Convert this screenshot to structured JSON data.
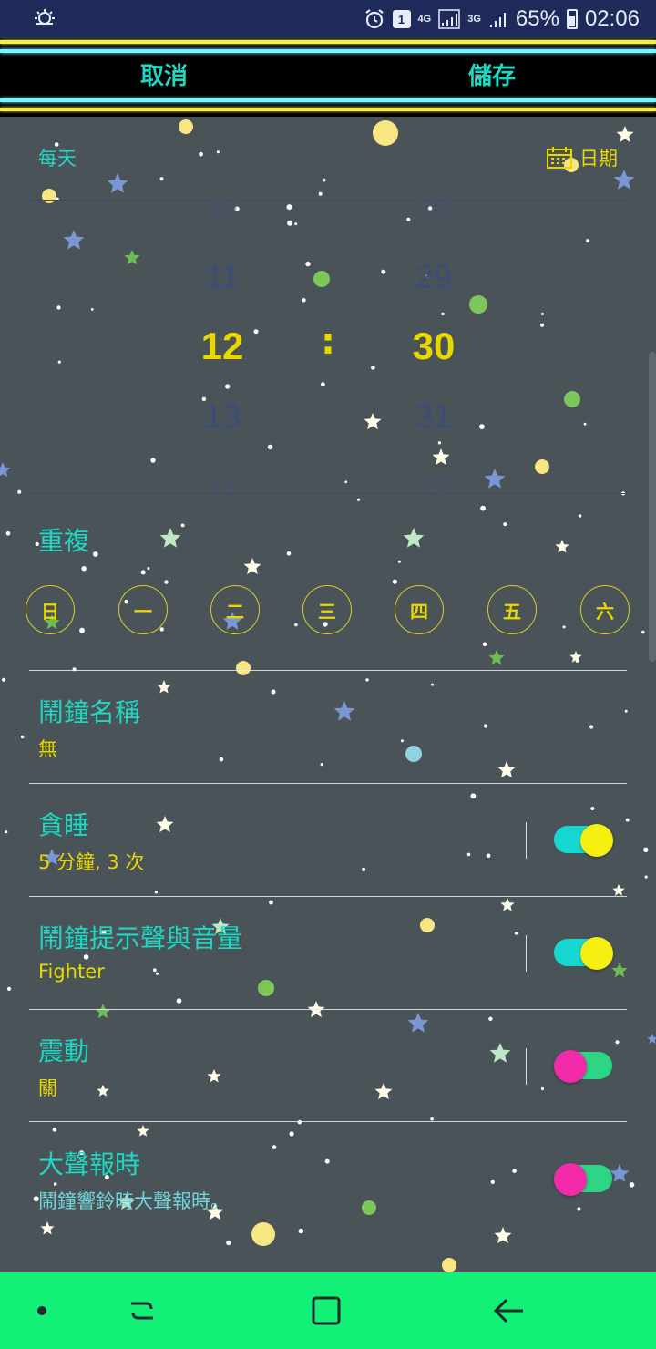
{
  "status_bar": {
    "left_icon": "weather-icon",
    "alarm_icon": "alarm-clock-icon",
    "sim_label": "1",
    "network1": "4G",
    "network2": "3G",
    "battery": "65%",
    "time": "02:06"
  },
  "top_bar": {
    "cancel": "取消",
    "save": "儲存"
  },
  "mode": {
    "label": "每天",
    "date_label": "日期",
    "date_icon": "calendar-icon"
  },
  "picker": {
    "hours": [
      "10",
      "11",
      "12",
      "13",
      "14"
    ],
    "minutes": [
      "28",
      "29",
      "30",
      "31",
      "32"
    ],
    "separator": ":"
  },
  "repeat": {
    "title": "重複",
    "days": [
      "日",
      "一",
      "二",
      "三",
      "四",
      "五",
      "六"
    ]
  },
  "settings": [
    {
      "title": "鬧鐘名稱",
      "subtitle": "無",
      "toggle": null
    },
    {
      "title": "貪睡",
      "subtitle": "5 分鐘, 3 次",
      "toggle": "on"
    },
    {
      "title": "鬧鐘提示聲與音量",
      "subtitle": "Fighter",
      "toggle": "on"
    },
    {
      "title": "震動",
      "subtitle": "關",
      "toggle": "off"
    },
    {
      "title": "大聲報時",
      "subtitle": "鬧鐘響鈴時大聲報時。",
      "toggle": "off"
    }
  ],
  "nav_bar": {
    "dot": "home-dot-icon",
    "recents": "recent-apps-icon",
    "home": "home-button-icon",
    "back": "back-arrow-icon"
  },
  "colors": {
    "background": "#4a5358",
    "accent_cyan": "#1fd8c4",
    "accent_yellow": "#e8d800",
    "nav_green": "#12f078",
    "toggle_on_track": "#17d8d0",
    "toggle_on_thumb": "#f5ee10",
    "toggle_off_track": "#2dd585",
    "toggle_off_thumb": "#f02aa8"
  }
}
